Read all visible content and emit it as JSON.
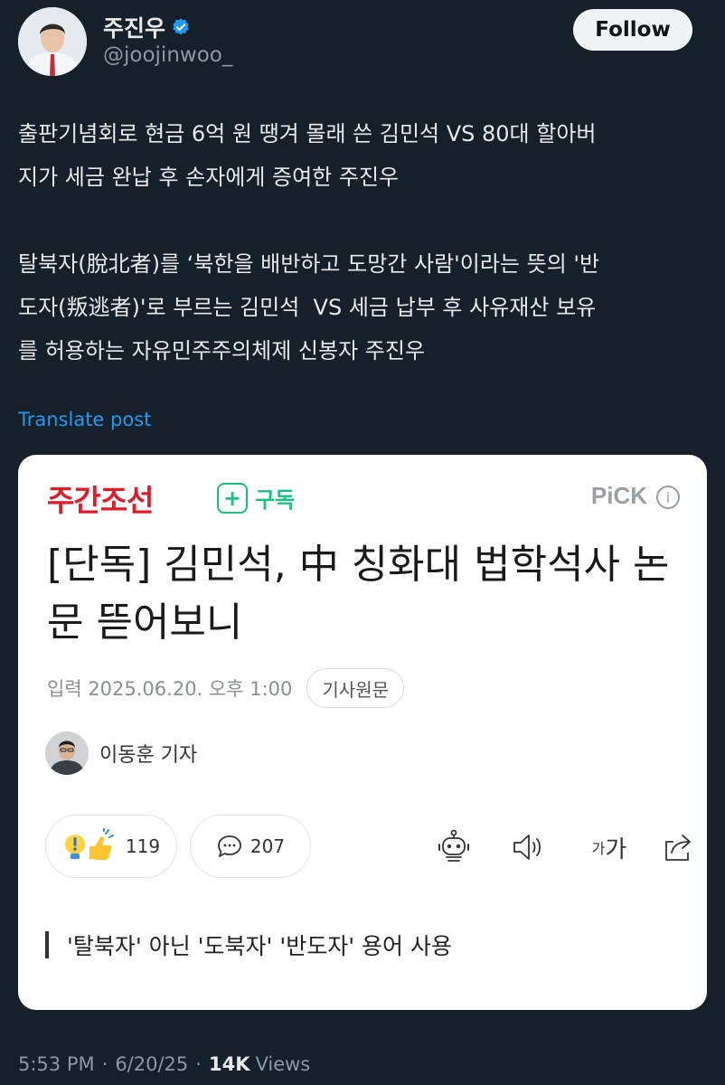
{
  "author": {
    "name": "주진우",
    "handle": "@joojinwoo_",
    "verified": true,
    "follow_label": "Follow"
  },
  "post": {
    "text": "출판기념회로 현금 6억 원 땡겨 몰래 쓴 김민석 VS 80대 할아버\n지가 세금 완납 후 손자에게 증여한 주진우\n\n탈북자(脫北者)를 ‘북한을 배반하고 도망간 사람'이라는 뜻의 '반\n도자(叛逃者)'로 부르는 김민석  VS 세금 납부 후 사유재산 보유\n를 허용하는 자유민주주의체제 신봉자 주진우",
    "translate_label": "Translate post"
  },
  "card": {
    "brand": "주간조선",
    "subscribe_label": "구독",
    "pick_label": "PiCK",
    "headline": "[단독] 김민석, 中 칭화대 법학석사 논문 뜯어보니",
    "published": "입력 2025.06.20. 오후 1:00",
    "source_label": "기사원문",
    "reporter": "이동훈 기자",
    "reaction_count": "119",
    "comment_count": "207",
    "font_label_small": "가",
    "font_label_large": "가",
    "quote": "'탈북자' 아닌 '도북자' '반도자' 용어 사용"
  },
  "footer": {
    "time": "5:53 PM",
    "date": "6/20/25",
    "views_count": "14K",
    "views_label": "Views"
  },
  "colors": {
    "background": "#15202b",
    "link": "#1d9bf0",
    "brand_red": "#e01b2a",
    "subscribe_green": "#19c37d",
    "verified_blue": "#1d9bf0"
  },
  "icons": [
    "verified-badge-icon",
    "plus-icon",
    "info-icon",
    "lightbulb-thumb-icon",
    "comment-bubble-icon",
    "robot-summary-icon",
    "speaker-icon",
    "share-icon"
  ]
}
